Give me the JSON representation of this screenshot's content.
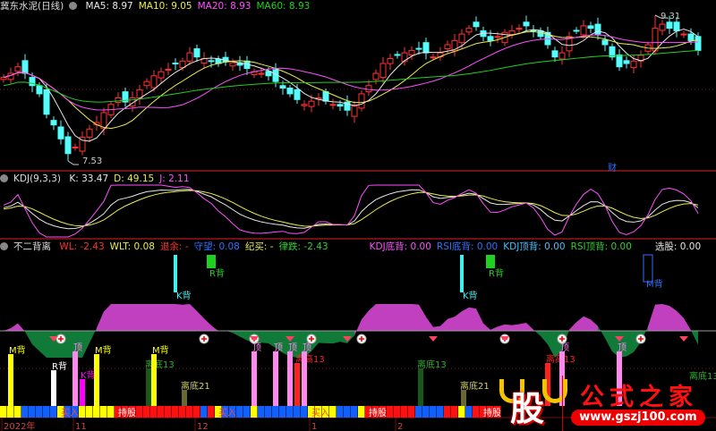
{
  "main": {
    "title": "冀东水泥(日线)",
    "ma": [
      {
        "label": "MA5: 8.97",
        "color": "#e8e8e8"
      },
      {
        "label": "MA10: 9.05",
        "color": "#ecec50"
      },
      {
        "label": "MA20: 8.93",
        "color": "#ff50ff"
      },
      {
        "label": "MA60: 8.93",
        "color": "#20d020"
      }
    ],
    "high_label": "9.31",
    "low_label": "7.53",
    "event_label": "财"
  },
  "kdj": {
    "title": "KDJ(9,3,3)",
    "values": [
      {
        "label": "K: 33.47",
        "color": "#e8e8e8"
      },
      {
        "label": "D: 49.15",
        "color": "#ecec50"
      },
      {
        "label": "J: 2.11",
        "color": "#ff50ff"
      }
    ]
  },
  "indicator": {
    "title": "不二背离",
    "values": [
      {
        "label": "WL: -2.43",
        "color": "#ff3030"
      },
      {
        "label": "WLT: 0.08",
        "color": "#ecec50"
      },
      {
        "label": "退余: -",
        "color": "#ff3030"
      },
      {
        "label": "守望: 0.08",
        "color": "#3070ff"
      },
      {
        "label": "纪买: -",
        "color": "#ecec50"
      },
      {
        "label": "律跌: -2.43",
        "color": "#30d030"
      },
      {
        "label": "KDJ底背: 0.00",
        "color": "#ff50ff"
      },
      {
        "label": "RSI底背: 0.00",
        "color": "#3070ff"
      },
      {
        "label": "KDJ顶背: 0.00",
        "color": "#40c0ff"
      },
      {
        "label": "RSI顶背: 0.00",
        "color": "#30d030"
      },
      {
        "label": "选股: 0.00",
        "color": "#e8e8e8"
      }
    ],
    "upper_signals": [
      {
        "index": 24,
        "label": "K背",
        "kind": "k",
        "color": "#40f0f0"
      },
      {
        "index": 29,
        "label": "R背",
        "kind": "r",
        "color": "#20d020"
      },
      {
        "index": 64,
        "label": "K背",
        "kind": "k",
        "color": "#40f0f0"
      },
      {
        "index": 68,
        "label": "R背",
        "kind": "r",
        "color": "#20d020"
      },
      {
        "index": 90,
        "label": "M背",
        "kind": "m",
        "color": "#3070ff"
      }
    ],
    "signals": [
      {
        "index": 1,
        "label": "M背",
        "color": "#ffff00",
        "height": 58
      },
      {
        "index": 7,
        "label": "R背",
        "color": "#ffffff",
        "height": 40
      },
      {
        "index": 10,
        "label": "顶",
        "color": "#ff88ee",
        "height": 61
      },
      {
        "index": 11,
        "label": "K背",
        "color": "#ff00ff",
        "height": 30
      },
      {
        "index": 13,
        "label": "M背",
        "color": "#ffff00",
        "height": 58
      },
      {
        "index": 20,
        "label": "离底13",
        "color": "#30b030",
        "height": 42,
        "thin": true
      },
      {
        "index": 21,
        "label": "M背",
        "color": "#ffff00",
        "height": 58
      },
      {
        "index": 25,
        "label": "离底21",
        "color": "#d0d060",
        "height": 18,
        "thin": true
      },
      {
        "index": 35,
        "label": "顶",
        "color": "#ff88ee",
        "height": 61
      },
      {
        "index": 38,
        "label": "顶",
        "color": "#ff88ee",
        "height": 61
      },
      {
        "index": 40,
        "label": "顶",
        "color": "#ff88ee",
        "height": 61
      },
      {
        "index": 41,
        "label": "离高13",
        "color": "#ff2020",
        "height": 48
      },
      {
        "index": 42,
        "label": "顶",
        "color": "#ff88ee",
        "height": 61
      },
      {
        "index": 58,
        "label": "离底13",
        "color": "#30b030",
        "height": 42,
        "thin": true
      },
      {
        "index": 64,
        "label": "离底21",
        "color": "#d0d060",
        "height": 18,
        "thin": true
      },
      {
        "index": 76,
        "label": "离高13",
        "color": "#ff2020",
        "height": 48
      },
      {
        "index": 78,
        "label": "顶",
        "color": "#ff88ee",
        "height": 61
      },
      {
        "index": 86,
        "label": "顶",
        "color": "#ff88ee",
        "height": 61
      },
      {
        "index": 96,
        "label": "离底13",
        "color": "#30b030",
        "height": 0,
        "thin": true
      }
    ],
    "buy_markers": [
      8,
      28,
      35,
      43,
      50,
      70,
      78,
      89
    ],
    "gem_markers": [
      7,
      35,
      40,
      48,
      60,
      70,
      86,
      95
    ],
    "band_states": "YYYBBBBBYBBYYYYYRRRRRRRRRRRRBRYBBBBYBBBBBBBYYYYBBBYRRRRRRRBBBBRRYBRRRR",
    "band_labels": [
      {
        "index": 8,
        "label": "买入",
        "color": "#ff4040"
      },
      {
        "index": 16,
        "label": "持股",
        "color": "#ffffff"
      },
      {
        "index": 30,
        "label": "买入",
        "color": "#ff4040"
      },
      {
        "index": 43,
        "label": "买入",
        "color": "#ff4040"
      },
      {
        "index": 51,
        "label": "持股",
        "color": "#ffffff"
      },
      {
        "index": 67,
        "label": "持股",
        "color": "#ffffff"
      }
    ]
  },
  "axis": {
    "labels": [
      {
        "index": 0,
        "label": "2022年"
      },
      {
        "index": 10,
        "label": "11"
      },
      {
        "index": 27,
        "label": "12"
      },
      {
        "index": 43,
        "label": "1"
      },
      {
        "index": 55,
        "label": "2"
      }
    ]
  },
  "logo": {
    "char": "股",
    "name": "公式之家",
    "url": "www.gszj100.com"
  },
  "chart_data": {
    "type": "candlestick",
    "title": "冀东水泥(日线)",
    "high": 9.31,
    "low": 7.53,
    "close": [
      8.55,
      8.6,
      8.68,
      8.6,
      8.45,
      8.35,
      8.1,
      7.97,
      7.8,
      7.62,
      7.7,
      7.82,
      7.92,
      8.0,
      8.12,
      8.22,
      8.3,
      8.25,
      8.3,
      8.4,
      8.5,
      8.57,
      8.62,
      8.65,
      8.72,
      8.75,
      8.85,
      8.8,
      8.78,
      8.75,
      8.72,
      8.74,
      8.73,
      8.7,
      8.66,
      8.62,
      8.6,
      8.57,
      8.5,
      8.42,
      8.35,
      8.28,
      8.22,
      8.26,
      8.3,
      8.26,
      8.22,
      8.2,
      8.15,
      8.2,
      8.35,
      8.45,
      8.6,
      8.72,
      8.78,
      8.82,
      8.85,
      8.88,
      8.9,
      8.85,
      8.8,
      8.85,
      8.95,
      9.0,
      9.08,
      9.15,
      9.17,
      9.05,
      9.0,
      9.05,
      9.1,
      9.12,
      9.15,
      9.18,
      9.12,
      9.05,
      8.95,
      8.8,
      8.85,
      9.05,
      9.12,
      9.18,
      9.15,
      9.08,
      8.95,
      8.8,
      8.68,
      8.72,
      8.75,
      8.82,
      8.95,
      9.15,
      9.2,
      9.15,
      9.12,
      9.08,
      9.0,
      8.88
    ],
    "ma_periods": [
      5,
      10,
      20,
      60
    ]
  }
}
